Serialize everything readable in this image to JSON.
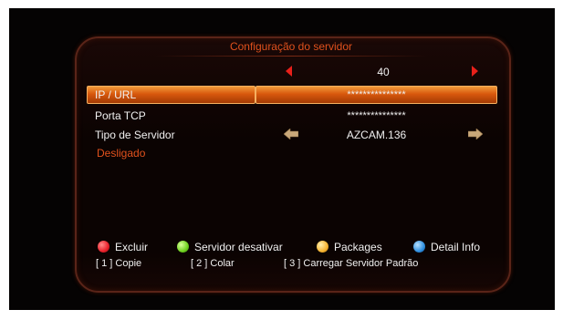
{
  "header": {
    "title": "Configuração do servidor"
  },
  "pager": {
    "value": "40"
  },
  "rows": [
    {
      "label": "IP / URL",
      "value": "***************"
    },
    {
      "label": "Porta TCP",
      "value": "***************"
    },
    {
      "label": "Tipo de Servidor",
      "value": "AZCAM.136"
    }
  ],
  "status": {
    "text": "Desligado"
  },
  "legend": [
    {
      "label": "Excluir",
      "color": "#e8202a"
    },
    {
      "label": "Servidor desativar",
      "color": "#6fd11f"
    },
    {
      "label": "Packages",
      "color": "#f5b331"
    },
    {
      "label": "Detail Info",
      "color": "#2f8fe0"
    }
  ],
  "hotkeys": [
    {
      "label": "[ 1 ] Copie"
    },
    {
      "label": "[ 2 ] Colar"
    },
    {
      "label": "[ 3 ] Carregar Servidor Padrão"
    }
  ],
  "colors": {
    "accent": "#e0511d",
    "selection": "#d8580d",
    "background": "#050303"
  },
  "icons": {
    "pager_left": "red-triangle-left-icon",
    "pager_right": "red-triangle-right-icon",
    "type_left": "tan-arrow-left-icon",
    "type_right": "tan-arrow-right-icon"
  }
}
